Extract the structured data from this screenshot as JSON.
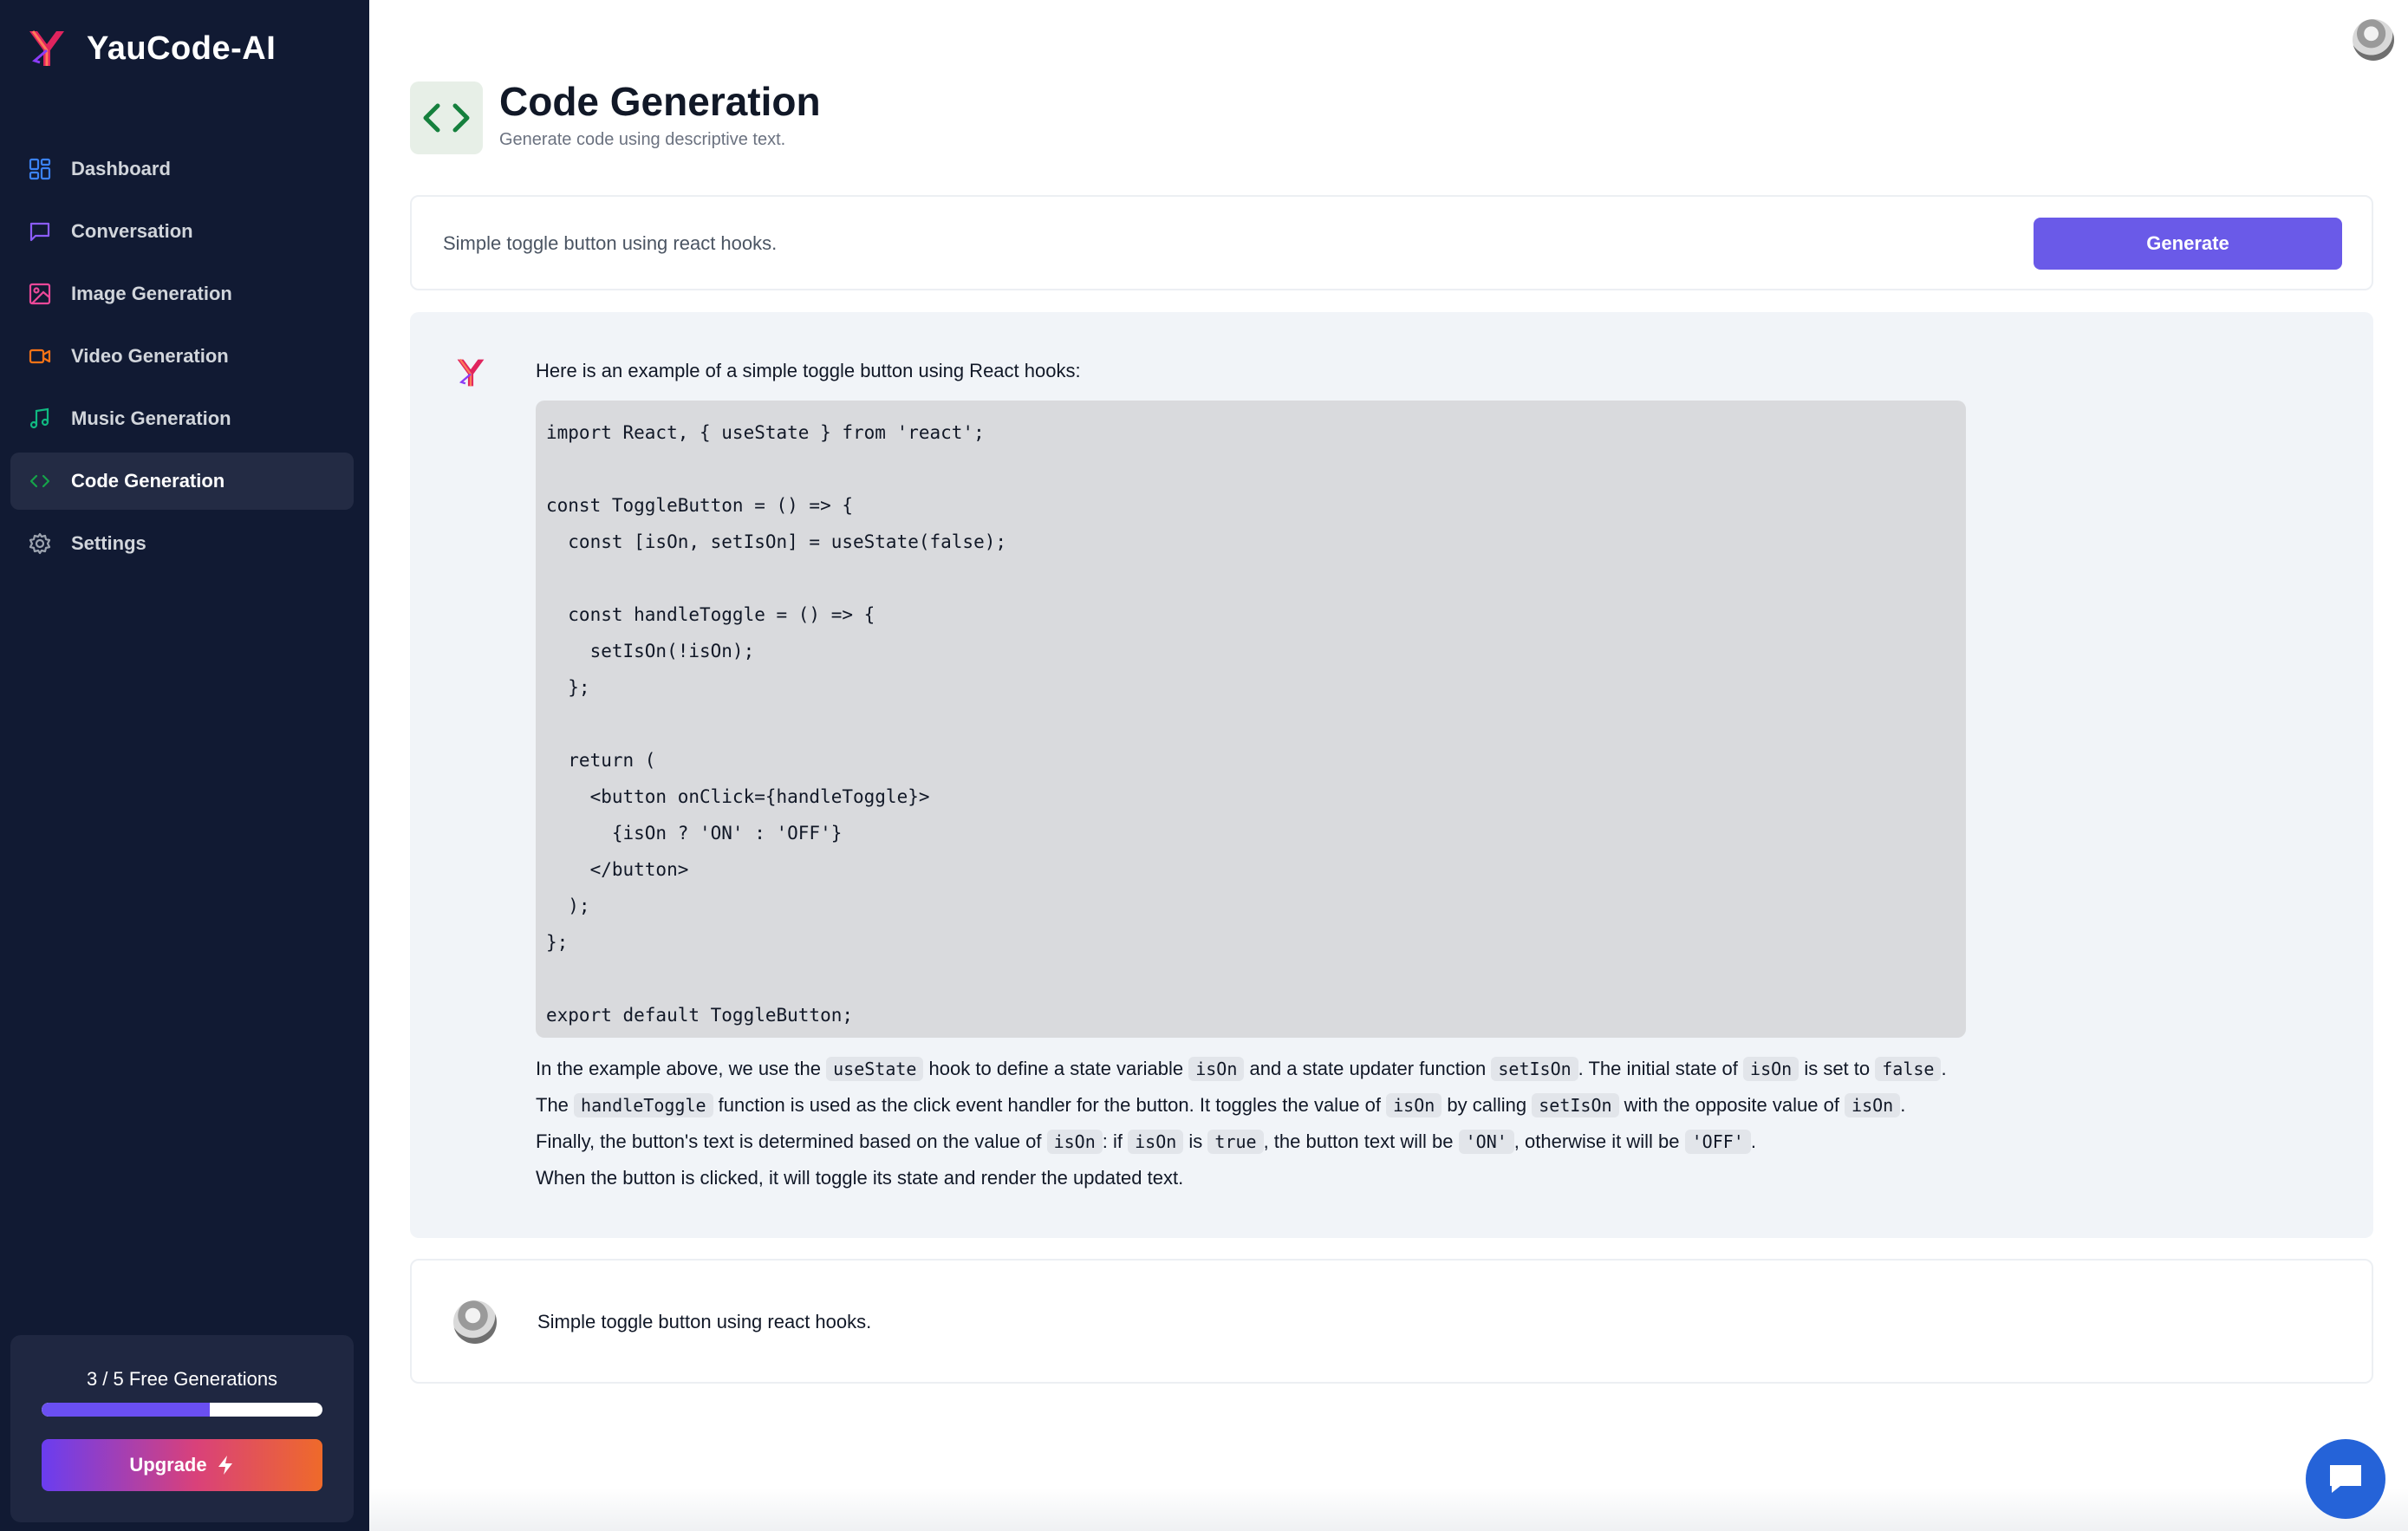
{
  "app": {
    "name": "YauCode-AI",
    "logo_icon": "yaucode-logo-icon"
  },
  "sidebar": {
    "items": [
      {
        "label": "Dashboard",
        "icon": "dashboard-icon",
        "color": "#3b82f6"
      },
      {
        "label": "Conversation",
        "icon": "chat-icon",
        "color": "#8b5cf6"
      },
      {
        "label": "Image Generation",
        "icon": "image-icon",
        "color": "#ec4899"
      },
      {
        "label": "Video Generation",
        "icon": "video-icon",
        "color": "#f97316"
      },
      {
        "label": "Music Generation",
        "icon": "music-icon",
        "color": "#10b981"
      },
      {
        "label": "Code Generation",
        "icon": "code-icon",
        "color": "#16a34a",
        "active": true
      },
      {
        "label": "Settings",
        "icon": "gear-icon",
        "color": "#9ca3af"
      }
    ],
    "quota": {
      "text": "3 / 5 Free Generations",
      "used": 3,
      "total": 5,
      "fraction": 0.6
    },
    "upgrade_label": "Upgrade"
  },
  "header": {
    "title": "Code Generation",
    "subtitle": "Generate code using descriptive text.",
    "icon": "code-icon"
  },
  "prompt": {
    "value": "Simple toggle button using react hooks.",
    "generate_label": "Generate"
  },
  "response": {
    "intro": "Here is an example of a simple toggle button using React hooks:",
    "code_lines": [
      "import React, { useState } from 'react';",
      "",
      "const ToggleButton = () => {",
      "  const [isOn, setIsOn] = useState(false);",
      "",
      "  const handleToggle = () => {",
      "    setIsOn(!isOn);",
      "  };",
      "",
      "  return (",
      "    <button onClick={handleToggle}>",
      "      {isOn ? 'ON' : 'OFF'}",
      "    </button>",
      "  );",
      "};",
      "",
      "export default ToggleButton;"
    ],
    "explanation": [
      [
        {
          "t": "In the example above, we use the "
        },
        {
          "c": "useState"
        },
        {
          "t": " hook to define a state variable "
        },
        {
          "c": "isOn"
        },
        {
          "t": " and a state updater function "
        },
        {
          "c": "setIsOn"
        },
        {
          "t": ". The initial state of "
        },
        {
          "c": "isOn"
        },
        {
          "t": " is set to "
        },
        {
          "c": "false"
        },
        {
          "t": "."
        }
      ],
      [
        {
          "t": "The "
        },
        {
          "c": "handleToggle"
        },
        {
          "t": " function is used as the click event handler for the button. It toggles the value of "
        },
        {
          "c": "isOn"
        },
        {
          "t": " by calling "
        },
        {
          "c": "setIsOn"
        },
        {
          "t": " with the opposite value of "
        },
        {
          "c": "isOn"
        },
        {
          "t": "."
        }
      ],
      [
        {
          "t": "Finally, the button's text is determined based on the value of "
        },
        {
          "c": "isOn"
        },
        {
          "t": ": if "
        },
        {
          "c": "isOn"
        },
        {
          "t": " is "
        },
        {
          "c": "true"
        },
        {
          "t": ", the button text will be "
        },
        {
          "c": "'ON'"
        },
        {
          "t": ", otherwise it will be "
        },
        {
          "c": "'OFF'"
        },
        {
          "t": "."
        }
      ],
      [
        {
          "t": "When the button is clicked, it will toggle its state and render the updated text."
        }
      ]
    ]
  },
  "user_message": {
    "text": "Simple toggle button using react hooks."
  },
  "colors": {
    "sidebar_bg": "#111a33",
    "accent": "#6a5ae8",
    "chat_fab": "#2563d8"
  }
}
